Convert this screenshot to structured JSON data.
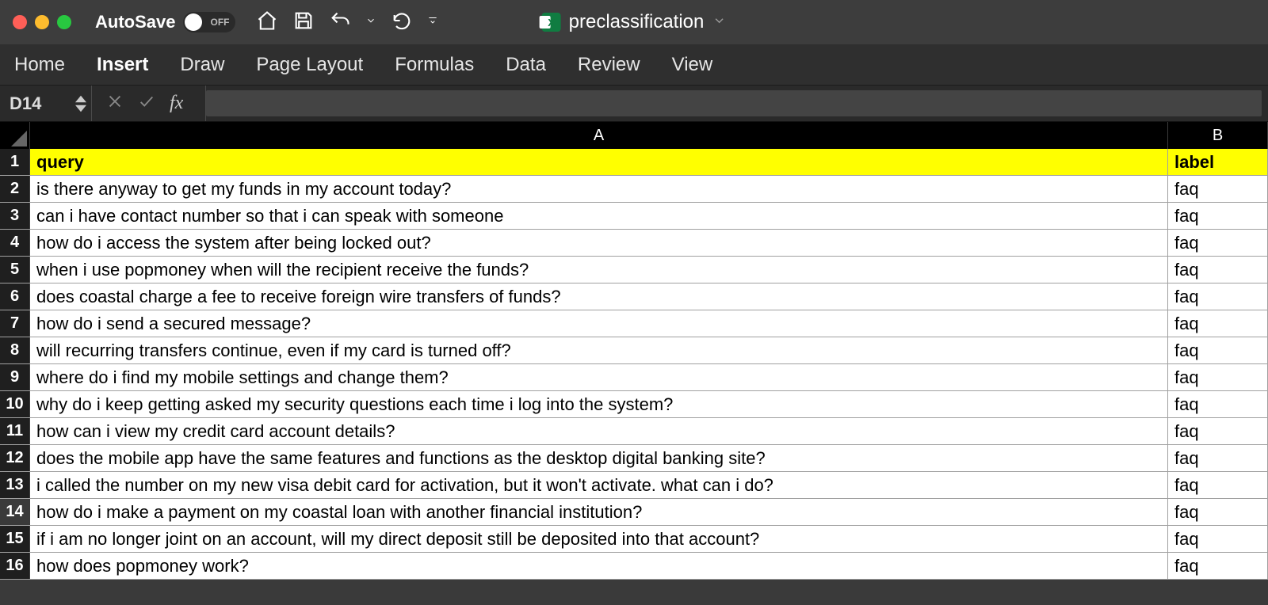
{
  "titlebar": {
    "autosave_label": "AutoSave",
    "autosave_state": "OFF",
    "document_name": "preclassification"
  },
  "ribbon": {
    "tabs": [
      "Home",
      "Insert",
      "Draw",
      "Page Layout",
      "Formulas",
      "Data",
      "Review",
      "View"
    ],
    "active_index": 1
  },
  "formula_bar": {
    "name_box": "D14",
    "fx_label": "fx",
    "formula_value": ""
  },
  "sheet": {
    "columns": [
      "A",
      "B"
    ],
    "header_row": {
      "num": 1,
      "query": "query",
      "label": "label"
    },
    "selected_rownum": 14,
    "rows": [
      {
        "num": 2,
        "query": "is there anyway to get my funds in my account today?",
        "label": "faq"
      },
      {
        "num": 3,
        "query": "can i have contact number so that i can speak with someone",
        "label": "faq"
      },
      {
        "num": 4,
        "query": "how do i access the system after being locked out?",
        "label": "faq"
      },
      {
        "num": 5,
        "query": "when i use popmoney when will the recipient receive the funds?",
        "label": "faq"
      },
      {
        "num": 6,
        "query": "does coastal charge a fee to receive foreign wire transfers of funds?",
        "label": "faq"
      },
      {
        "num": 7,
        "query": "how do i send a secured message?",
        "label": "faq"
      },
      {
        "num": 8,
        "query": "will recurring transfers continue, even if my card is turned off?",
        "label": "faq"
      },
      {
        "num": 9,
        "query": "where do i find my mobile settings and change them?",
        "label": "faq"
      },
      {
        "num": 10,
        "query": "why do i keep getting asked my security questions each time i log into the system?",
        "label": "faq"
      },
      {
        "num": 11,
        "query": "how can i view my credit card account details?",
        "label": "faq"
      },
      {
        "num": 12,
        "query": "does the mobile app have the same features and functions as the desktop digital banking site?",
        "label": "faq"
      },
      {
        "num": 13,
        "query": "i called the number on my new visa debit card for activation, but it won't activate. what can i do?",
        "label": "faq"
      },
      {
        "num": 14,
        "query": "how do i make a payment on my coastal loan with another financial institution?",
        "label": "faq"
      },
      {
        "num": 15,
        "query": "if i am no longer joint on an account, will my direct deposit still be deposited into that account?",
        "label": "faq"
      },
      {
        "num": 16,
        "query": "how does popmoney work?",
        "label": "faq"
      }
    ]
  }
}
